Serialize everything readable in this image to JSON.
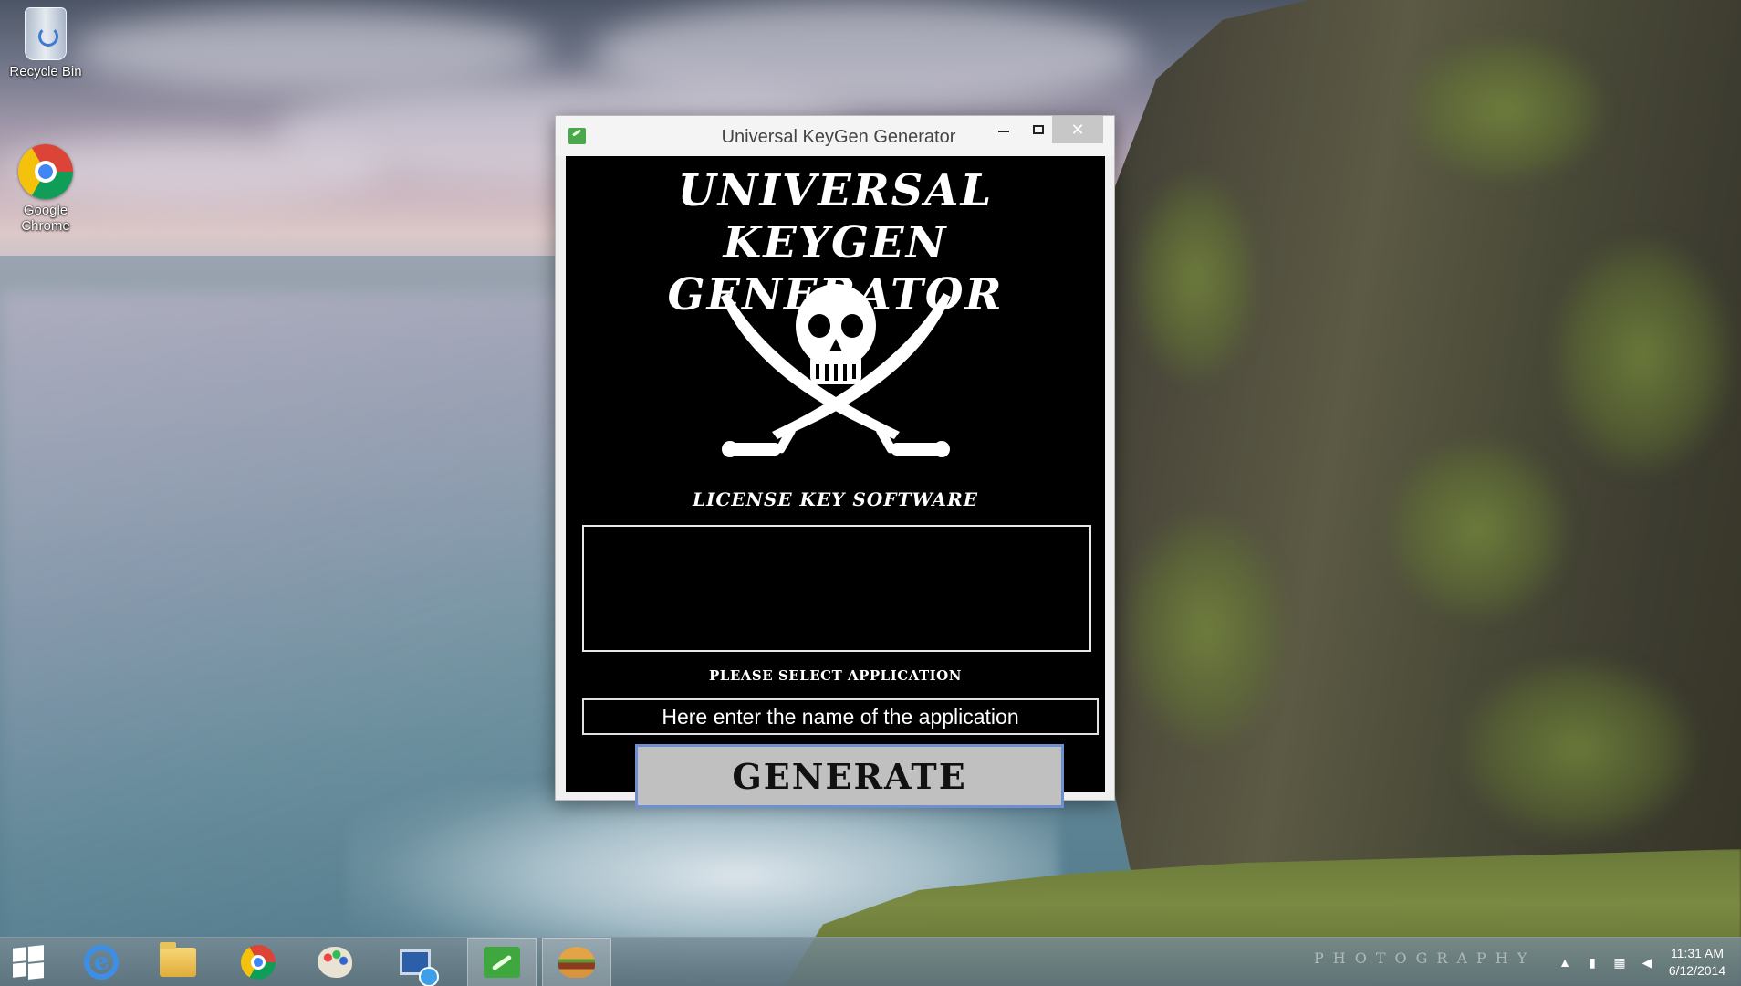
{
  "desktop": {
    "icons": [
      {
        "label": "Recycle Bin",
        "icon": "recycle-bin-icon"
      },
      {
        "label": "Google Chrome",
        "icon": "chrome-icon"
      }
    ],
    "watermark": "PHOTOGRAPHY"
  },
  "window": {
    "title": "Universal KeyGen Generator",
    "close_label": "✕",
    "headline_line1": "UNIVERSAL KEYGEN",
    "headline_line2": "GENERATOR",
    "tagline": "LICENSE KEY SOFTWARE",
    "output_value": "",
    "select_label": "PLEASE SELECT APPLICATION",
    "app_name_value": "Here enter the name of the application",
    "generate_label": "GENERATE",
    "logo_icon": "skull-crossed-swords-icon",
    "colors": {
      "body_bg": "#000000",
      "button_bg": "#c0c0c0",
      "button_border": "#6f8fd0"
    }
  },
  "taskbar": {
    "items": [
      {
        "name": "start",
        "icon": "windows-start-icon"
      },
      {
        "name": "internet-explorer",
        "icon": "internet-explorer-icon"
      },
      {
        "name": "file-explorer",
        "icon": "folder-icon"
      },
      {
        "name": "chrome",
        "icon": "chrome-icon"
      },
      {
        "name": "paint",
        "icon": "paint-palette-icon"
      },
      {
        "name": "network",
        "icon": "network-computer-icon"
      },
      {
        "name": "keygen-app",
        "icon": "keygen-app-icon",
        "active": true
      },
      {
        "name": "burger-app",
        "icon": "burger-icon",
        "active": true
      }
    ],
    "clock_time": "11:31 AM",
    "clock_date": "6/12/2014"
  }
}
